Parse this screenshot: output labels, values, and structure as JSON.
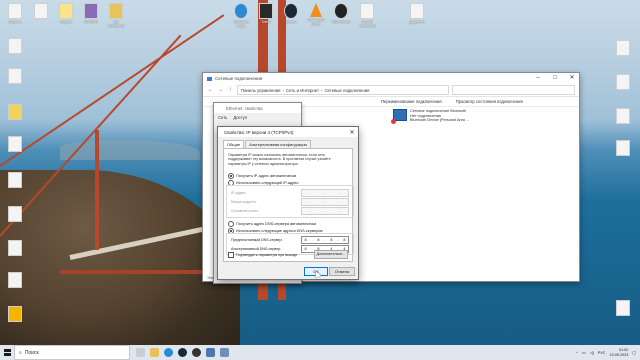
{
  "desktop": {
    "icons_top": [
      {
        "label": "Корзина"
      },
      {
        "label": ""
      },
      {
        "label": "Яндекс"
      },
      {
        "label": "WinRAR"
      },
      {
        "label": "кар лайфвера"
      },
      {
        "label": "Microsoft Edge"
      },
      {
        "label": "Twitch"
      },
      {
        "label": "Steam"
      },
      {
        "label": "VLC media player"
      },
      {
        "label": "OBS Studio"
      },
      {
        "label": "Новый текстовый"
      },
      {
        "label": "Документ"
      }
    ]
  },
  "explorer": {
    "title": "Сетевые подключения",
    "address": [
      "Панель управления",
      "Сеть и Интернет",
      "Сетевые подключения"
    ],
    "search_placeholder": "",
    "commands": [
      "Переименование подключения",
      "Просмотр состояния подключения"
    ],
    "network_left": {
      "name": "Ethernet",
      "sub": "PCI-E Ethernet",
      "adapter": "Realtek PCIe GBE Family"
    },
    "network_item": {
      "name": "Сетевое подключение Bluetooth",
      "status": "Нет подключения",
      "adapter": "Bluetooth Device (Personal Area ..."
    },
    "status_bar": "Элементов: 2    Выбран 1 элемент"
  },
  "props_dialog": {
    "title": "Ethernet: свойства",
    "tabs": [
      "Сеть",
      "Доступ"
    ]
  },
  "ipv4_dialog": {
    "title": "Свойства: IP версии 4 (TCP/IPv4)",
    "tabs": [
      "Общие",
      "Альтернативная конфигурация"
    ],
    "description": "Параметры IP можно назначать автоматически, если сеть поддерживает эту возможность. В противном случае узнайте параметры IP у сетевого администратора.",
    "radio_auto_ip": "Получить IP-адрес автоматически",
    "radio_manual_ip": "Использовать следующий IP-адрес:",
    "ip_label": "IP-адрес:",
    "mask_label": "Маска подсети:",
    "gateway_label": "Основной шлюз:",
    "radio_auto_dns": "Получить адрес DNS-сервера автоматически",
    "radio_manual_dns": "Использовать следующие адреса DNS-серверов:",
    "dns_pref_label": "Предпочитаемый DNS-сервер:",
    "dns_alt_label": "Альтернативный DNS-сервер:",
    "dns_pref": [
      "8",
      "8",
      "8",
      "8"
    ],
    "dns_alt": [
      "8",
      "8",
      "4",
      "4"
    ],
    "validate_label": "Подтвердить параметры при выходе",
    "advanced_label": "Дополнительно...",
    "ok_label": "ОК",
    "cancel_label": "Отмена"
  },
  "taskbar": {
    "search_label": "Поиск",
    "lang": "РУС",
    "time": "01:02",
    "date": "13.05.2023"
  }
}
